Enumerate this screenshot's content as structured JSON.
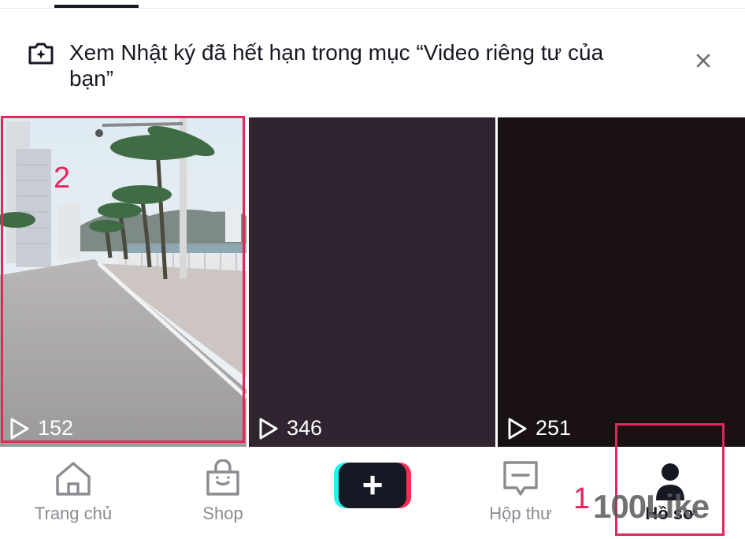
{
  "banner": {
    "text": "Xem Nhật ký đã hết hạn trong mục “Video riêng tư của bạn”",
    "icon": "camera-plus-icon",
    "close_icon": "close-icon"
  },
  "videos": [
    {
      "views": "152"
    },
    {
      "views": "346"
    },
    {
      "views": "251"
    }
  ],
  "annotations": {
    "step_video": "2",
    "step_profile": "1",
    "highlight_color": "#e8245d"
  },
  "nav": {
    "items": [
      {
        "label": "Trang chủ",
        "icon": "home-icon"
      },
      {
        "label": "Shop",
        "icon": "shopping-bag-icon"
      },
      {
        "label": "Hộp thư",
        "icon": "inbox-icon"
      },
      {
        "label": "Hồ sơ",
        "icon": "profile-icon"
      }
    ],
    "create_label": "+"
  },
  "watermark": "100Like"
}
